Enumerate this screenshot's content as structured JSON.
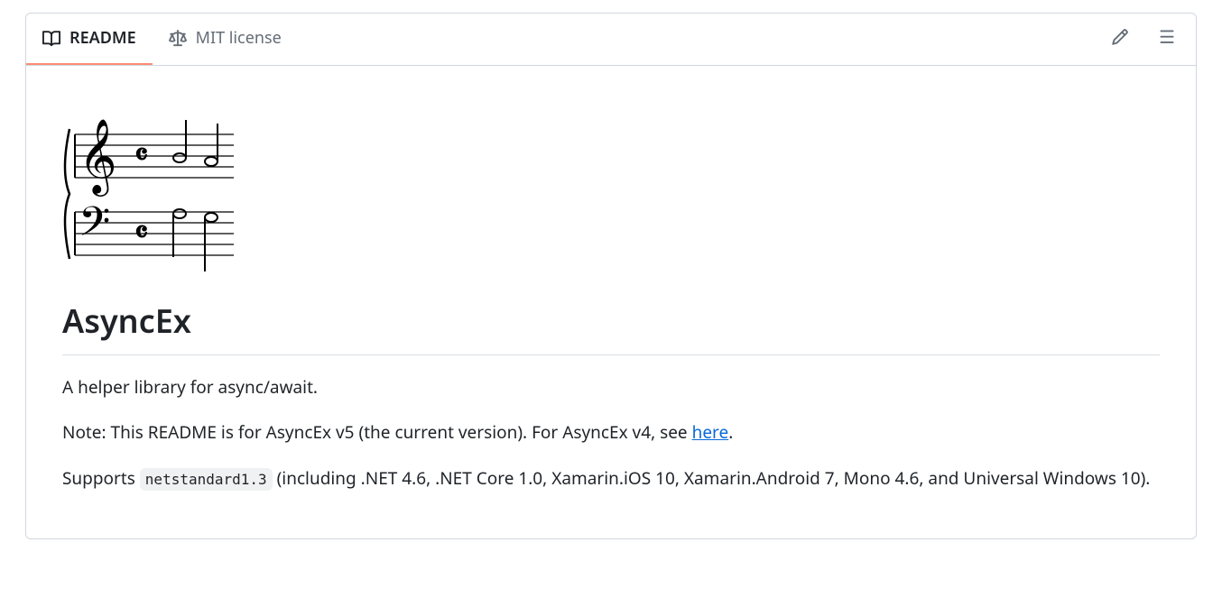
{
  "tabs": {
    "readme": "README",
    "license": "MIT license"
  },
  "readme": {
    "title": "AsyncEx",
    "description": "A helper library for async/await.",
    "note_prefix": "Note: This README is for AsyncEx v5 (the current version). For AsyncEx v4, see ",
    "note_link": "here",
    "note_suffix": ".",
    "supports_prefix": "Supports ",
    "supports_code": "netstandard1.3",
    "supports_suffix": " (including .NET 4.6, .NET Core 1.0, Xamarin.iOS 10, Xamarin.Android 7, Mono 4.6, and Universal Windows 10)."
  }
}
